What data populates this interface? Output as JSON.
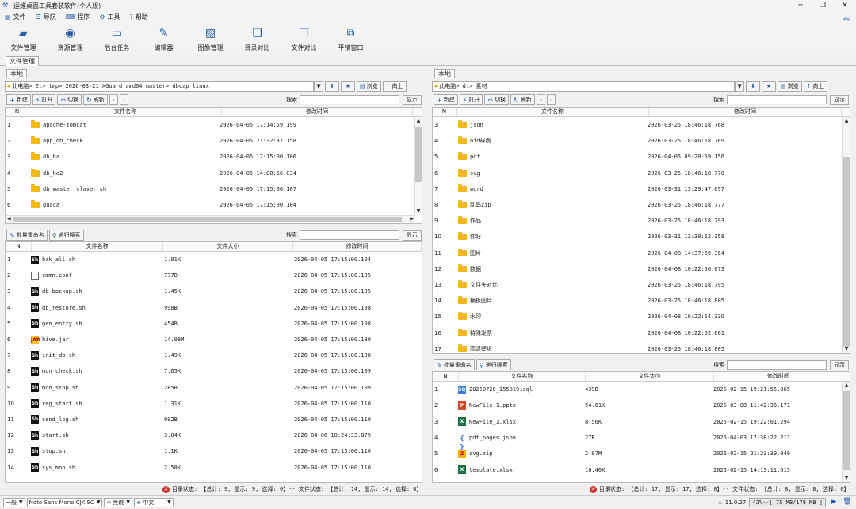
{
  "window": {
    "title": "运维桌面工具套装软件(个人版)"
  },
  "menu": [
    {
      "icon": "file-icon",
      "label": "文件"
    },
    {
      "icon": "nav-icon",
      "label": "导航"
    },
    {
      "icon": "program-icon",
      "label": "程序"
    },
    {
      "icon": "tools-icon",
      "label": "工具"
    },
    {
      "icon": "help-icon",
      "label": "帮助"
    }
  ],
  "toolbar": [
    {
      "label": "文件管理"
    },
    {
      "label": "资源管理"
    },
    {
      "label": "后台任务"
    },
    {
      "label": "编辑器"
    },
    {
      "label": "图像管理"
    },
    {
      "label": "目录对比"
    },
    {
      "label": "文件对比"
    },
    {
      "label": "平铺窗口"
    }
  ],
  "main_tab": "文件管理",
  "left": {
    "tab": "本地",
    "path": "此电脑> E:> tmp> 2026-03-21_XGuard_amd64_master> dbcap_linux",
    "browse": "浏览",
    "up": "向上",
    "actions": {
      "new": "新建",
      "open": "打开",
      "switch": "切换",
      "refresh": "刷新"
    },
    "search_label": "搜索",
    "show": "显示",
    "dir_headers": {
      "n": "N",
      "name": "文件名称",
      "mtime": "修改时间"
    },
    "dirs": [
      {
        "n": "1",
        "name": "apache-tomcat",
        "mtime": "2026-04-05 17:14:59.199"
      },
      {
        "n": "2",
        "name": "app_db_check",
        "mtime": "2026-04-05 21:32:37.158"
      },
      {
        "n": "3",
        "name": "db_ha",
        "mtime": "2026-04-05 17:15:00.106"
      },
      {
        "n": "4",
        "name": "db_ha2",
        "mtime": "2026-04-06 14:08:56.034"
      },
      {
        "n": "5",
        "name": "db_master_slaver_sh",
        "mtime": "2026-04-05 17:15:00.107"
      },
      {
        "n": "6",
        "name": "guaca",
        "mtime": "2026-04-05 17:15:00.104"
      }
    ],
    "batch_rename": "批量重命名",
    "recursive_search": "递归搜索",
    "file_headers": {
      "n": "N",
      "name": "文件名称",
      "size": "文件大小",
      "mtime": "修改时间"
    },
    "files": [
      {
        "n": "1",
        "type": "sh",
        "name": "bak_all.sh",
        "size": "1.91K",
        "mtime": "2026-04-05 17:15:00.104"
      },
      {
        "n": "2",
        "type": "doc",
        "name": "cmmn.conf",
        "size": "777B",
        "mtime": "2026-04-05 17:15:00.105"
      },
      {
        "n": "3",
        "type": "sh",
        "name": "db_backup.sh",
        "size": "1.45K",
        "mtime": "2026-04-05 17:15:00.105"
      },
      {
        "n": "4",
        "type": "sh",
        "name": "db_restore.sh",
        "size": "998B",
        "mtime": "2026-04-05 17:15:00.108"
      },
      {
        "n": "5",
        "type": "sh",
        "name": "gen_entry.sh",
        "size": "454B",
        "mtime": "2026-04-05 17:15:00.108"
      },
      {
        "n": "6",
        "type": "jar",
        "name": "hive.jar",
        "size": "14.98M",
        "mtime": "2026-04-05 17:15:00.180"
      },
      {
        "n": "7",
        "type": "sh",
        "name": "init_db.sh",
        "size": "1.49K",
        "mtime": "2026-04-05 17:15:00.108"
      },
      {
        "n": "8",
        "type": "sh",
        "name": "mon_check.sh",
        "size": "7.65K",
        "mtime": "2026-04-05 17:15:00.109"
      },
      {
        "n": "9",
        "type": "sh",
        "name": "mon_stop.sh",
        "size": "285B",
        "mtime": "2026-04-05 17:15:00.109"
      },
      {
        "n": "10",
        "type": "sh",
        "name": "reg_start.sh",
        "size": "1.31K",
        "mtime": "2026-04-05 17:15:00.110"
      },
      {
        "n": "11",
        "type": "sh",
        "name": "send_log.sh",
        "size": "992B",
        "mtime": "2026-04-05 17:15:00.110"
      },
      {
        "n": "12",
        "type": "sh",
        "name": "start.sh",
        "size": "3.04K",
        "mtime": "2026-04-06 10:24:33.879"
      },
      {
        "n": "13",
        "type": "sh",
        "name": "stop.sh",
        "size": "1.1K",
        "mtime": "2026-04-05 17:15:00.110"
      },
      {
        "n": "14",
        "type": "sh",
        "name": "sys_mon.sh",
        "size": "2.58K",
        "mtime": "2026-04-05 17:15:00.110"
      }
    ],
    "status": "目录状态: 【总计: 9, 显示: 9, 选择: 0】-- 文件状态: 【总计: 14, 显示: 14, 选择: 0】"
  },
  "right": {
    "tab": "本地",
    "path": "此电脑> d:> 素材",
    "browse": "浏览",
    "up": "向上",
    "actions": {
      "new": "新建",
      "open": "打开",
      "switch": "切换",
      "refresh": "刷新"
    },
    "search_label": "搜索",
    "show": "显示",
    "dir_headers": {
      "n": "N",
      "name": "文件名称",
      "mtime": "修改时间"
    },
    "dirs": [
      {
        "n": "3",
        "name": "json",
        "mtime": "2026-03-25 18:46:18.768"
      },
      {
        "n": "4",
        "name": "ofd样例",
        "mtime": "2026-03-25 18:46:18.769"
      },
      {
        "n": "5",
        "name": "pdf",
        "mtime": "2026-04-05 09:20:59.156"
      },
      {
        "n": "6",
        "name": "svg",
        "mtime": "2026-03-25 18:46:18.770"
      },
      {
        "n": "7",
        "name": "word",
        "mtime": "2026-03-31 13:29:47.697"
      },
      {
        "n": "8",
        "name": "乱码zip",
        "mtime": "2026-03-25 18:46:18.777"
      },
      {
        "n": "9",
        "name": "作品",
        "mtime": "2026-03-25 18:46:18.793"
      },
      {
        "n": "10",
        "name": "你好",
        "mtime": "2026-03-31 13:30:52.358"
      },
      {
        "n": "11",
        "name": "图片",
        "mtime": "2026-04-08 14:37:59.364"
      },
      {
        "n": "12",
        "name": "数据",
        "mtime": "2026-04-08 10:22:56.073"
      },
      {
        "n": "13",
        "name": "文件夹对比",
        "mtime": "2026-03-25 18:46:18.795"
      },
      {
        "n": "14",
        "name": "横板图片",
        "mtime": "2026-03-25 18:46:18.805"
      },
      {
        "n": "15",
        "name": "水印",
        "mtime": "2026-04-08 10:22:54.330"
      },
      {
        "n": "16",
        "name": "特殊发票",
        "mtime": "2026-04-08 10:22:52.661"
      },
      {
        "n": "17",
        "name": "高清壁纸",
        "mtime": "2026-03-25 18:46:18.805"
      }
    ],
    "batch_rename": "批量重命名",
    "recursive_search": "递归搜索",
    "file_headers": {
      "n": "N",
      "name": "文件名称",
      "size": "文件大小",
      "mtime": "修改时间"
    },
    "files": [
      {
        "n": "1",
        "type": "sql",
        "name": "20250720_155819.sql",
        "size": "439B",
        "mtime": "2026-02-15 19:21:55.865"
      },
      {
        "n": "2",
        "type": "ppt",
        "name": "NewFile_1.pptx",
        "size": "54.61K",
        "mtime": "2026-03-08 11:42:36.171"
      },
      {
        "n": "3",
        "type": "xls",
        "name": "NewFile_1.xlsx",
        "size": "8.56K",
        "mtime": "2026-02-15 19:22:01.294"
      },
      {
        "n": "4",
        "type": "json",
        "name": "pdf_pages.json",
        "size": "27B",
        "mtime": "2026-04-03 17:38:22.211"
      },
      {
        "n": "5",
        "type": "zip",
        "name": "svg.zip",
        "size": "2.07M",
        "mtime": "2026-02-15 21:23:39.049"
      },
      {
        "n": "6",
        "type": "xls",
        "name": "template.xlsx",
        "size": "10.46K",
        "mtime": "2026-02-15 14:13:11.615"
      }
    ],
    "status": "目录状态: 【总计: 17, 显示: 17, 选择: 0】-- 文件状态: 【总计: 8, 显示: 8, 选择: 0】"
  },
  "bottom": {
    "mode": "一般",
    "font": "Noto Sans Mono CJK SC",
    "style": "黑碗",
    "lang": "中文",
    "version": "11.0.27",
    "memory": "42%--[ 75 MB/178 MB ]"
  },
  "colors": {
    "accent": "#2a5da8",
    "folder": "#f2b90f",
    "error": "#d32f2f"
  }
}
